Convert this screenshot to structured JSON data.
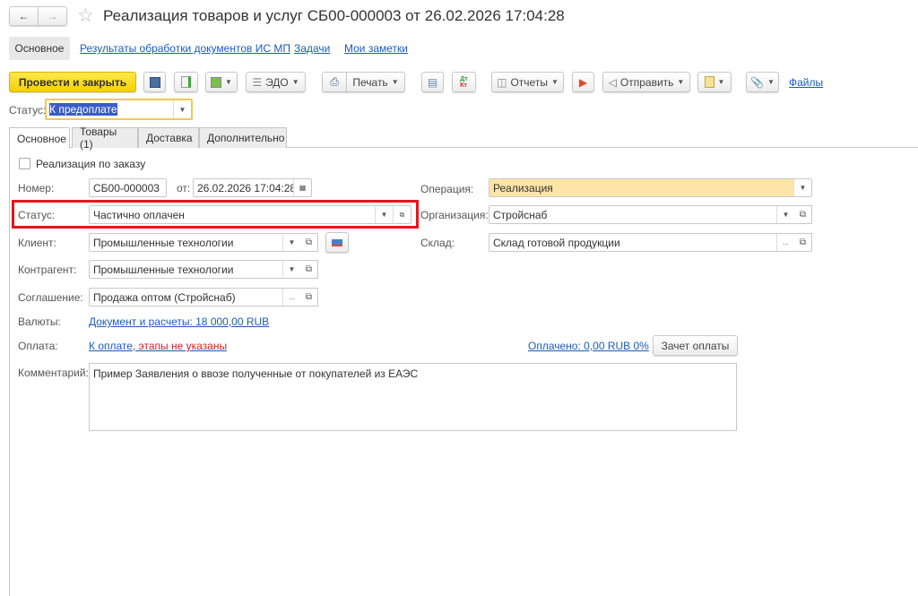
{
  "title": "Реализация товаров и услуг СБ00-000003 от 26.02.2026 17:04:28",
  "nav_tabs": [
    "Основное",
    "Результаты обработки документов ИС МП",
    "Задачи",
    "Мои заметки"
  ],
  "toolbar": {
    "post_close": "Провести и закрыть",
    "edo": "ЭДО",
    "print": "Печать",
    "reports": "Отчеты",
    "send": "Отправить",
    "files": "Файлы"
  },
  "header_status": {
    "label": "Статус:",
    "value": "К предоплате"
  },
  "form_tabs": [
    "Основное",
    "Товары (1)",
    "Доставка",
    "Дополнительно"
  ],
  "form": {
    "by_order": "Реализация по заказу",
    "number_label": "Номер:",
    "number": "СБ00-000003",
    "date_label": "от:",
    "date": "26.02.2026 17:04:28",
    "status_label": "Статус:",
    "status": "Частично оплачен",
    "client_label": "Клиент:",
    "client": "Промышленные технологии",
    "counterparty_label": "Контрагент:",
    "counterparty": "Промышленные технологии",
    "agreement_label": "Соглашение:",
    "agreement": "Продажа оптом (Стройснаб)",
    "currency_label": "Валюты:",
    "currency_link": "Документ и расчеты: 18 000,00 RUB",
    "payment_label": "Оплата:",
    "payment_link_a": "К оплате,",
    "payment_link_b": " этапы не указаны",
    "paid_link": "Оплачено: 0,00 RUB 0%",
    "offset_button": "Зачет оплаты",
    "comment_label": "Комментарий:",
    "comment": "Пример Заявления о ввозе полученные от покупателей из ЕАЭС",
    "operation_label": "Операция:",
    "operation": "Реализация",
    "organization_label": "Организация:",
    "organization": "Стройснаб",
    "warehouse_label": "Склад:",
    "warehouse": "Склад готовой продукции"
  }
}
